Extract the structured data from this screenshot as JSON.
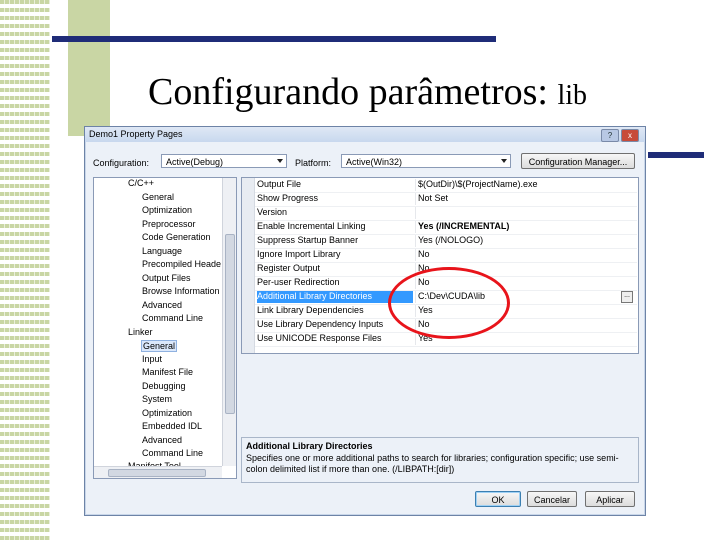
{
  "slide": {
    "title": "Configurando parâmetros:",
    "subtitle": "lib"
  },
  "colors": {
    "accent_bar": "#1f2c78",
    "stripe": "#c9d6a4",
    "highlight_ellipse": "#e8141b",
    "selection": "#3399ff"
  },
  "dialog": {
    "title": "Demo1 Property Pages",
    "help_label": "?",
    "close_label": "x",
    "configuration_label": "Configuration:",
    "configuration_value": "Active(Debug)",
    "platform_label": "Platform:",
    "platform_value": "Active(Win32)",
    "config_manager_label": "Configuration Manager...",
    "tree": {
      "items": [
        "C/C++",
        "General",
        "Optimization",
        "Preprocessor",
        "Code Generation",
        "Language",
        "Precompiled Heade",
        "Output Files",
        "Browse Information",
        "Advanced",
        "Command Line",
        "Linker",
        "General",
        "Input",
        "Manifest File",
        "Debugging",
        "System",
        "Optimization",
        "Embedded IDL",
        "Advanced",
        "Command Line",
        "Manifest Tool"
      ]
    },
    "properties": [
      {
        "name": "Output File",
        "value": "$(OutDir)\\$(ProjectName).exe"
      },
      {
        "name": "Show Progress",
        "value": "Not Set"
      },
      {
        "name": "Version",
        "value": ""
      },
      {
        "name": "Enable Incremental Linking",
        "value": "Yes (/INCREMENTAL)"
      },
      {
        "name": "Suppress Startup Banner",
        "value": "Yes (/NOLOGO)"
      },
      {
        "name": "Ignore Import Library",
        "value": "No"
      },
      {
        "name": "Register Output",
        "value": "No"
      },
      {
        "name": "Per-user Redirection",
        "value": "No"
      },
      {
        "name": "Additional Library Directories",
        "value": "C:\\Dev\\CUDA\\lib"
      },
      {
        "name": "Link Library Dependencies",
        "value": "Yes"
      },
      {
        "name": "Use Library Dependency Inputs",
        "value": "No"
      },
      {
        "name": "Use UNICODE Response Files",
        "value": "Yes"
      }
    ],
    "ellipsis_label": "...",
    "description": {
      "title": "Additional Library Directories",
      "text": "Specifies one or more additional paths to search for libraries; configuration specific; use semi-colon delimited list if more than one.   (/LIBPATH:[dir])"
    },
    "buttons": {
      "ok": "OK",
      "cancel": "Cancelar",
      "apply": "Aplicar"
    }
  }
}
